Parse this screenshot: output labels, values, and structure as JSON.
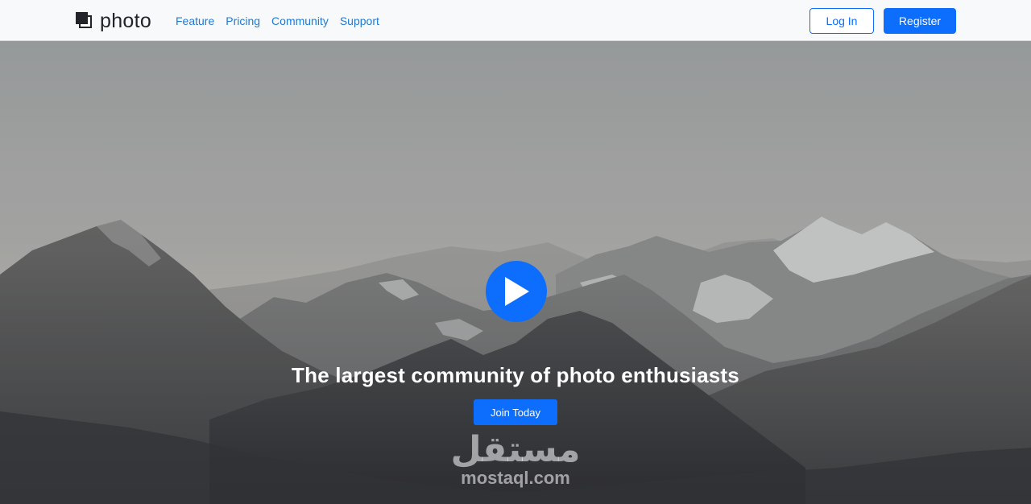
{
  "nav": {
    "brand": "photo",
    "links": [
      "Feature",
      "Pricing",
      "Community",
      "Support"
    ],
    "login": "Log In",
    "register": "Register"
  },
  "hero": {
    "title": "The largest community of photo enthusiasts",
    "cta": "Join Today",
    "play_icon": "play-icon"
  },
  "watermark": {
    "arabic": "مستقل",
    "latin": "mostaql.com"
  },
  "colors": {
    "primary": "#0d6efd",
    "nav_link": "#1f7ad1",
    "navbar_bg": "#f8f9fa"
  }
}
